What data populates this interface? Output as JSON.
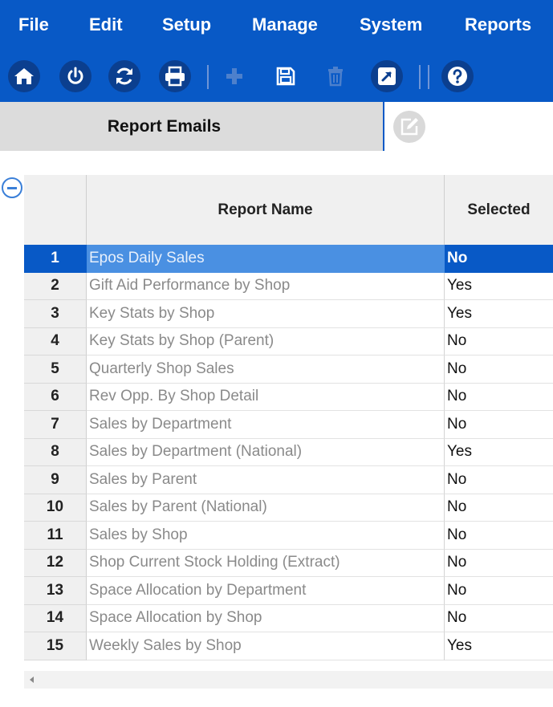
{
  "menu": {
    "file": "File",
    "edit": "Edit",
    "setup": "Setup",
    "manage": "Manage",
    "system": "System",
    "reports": "Reports"
  },
  "toolbar": {
    "icons": [
      "home-icon",
      "power-icon",
      "refresh-icon",
      "print-icon",
      "add-icon",
      "save-icon",
      "delete-icon",
      "export-icon",
      "help-icon"
    ],
    "disabled": [
      "add-icon",
      "delete-icon"
    ]
  },
  "tab": {
    "label": "Report Emails"
  },
  "grid": {
    "headers": {
      "name": "Report Name",
      "selected": "Selected"
    },
    "rows": [
      {
        "num": "1",
        "name": "Epos Daily Sales",
        "selected": "No"
      },
      {
        "num": "2",
        "name": "Gift Aid Performance by Shop",
        "selected": "Yes"
      },
      {
        "num": "3",
        "name": "Key Stats by Shop",
        "selected": "Yes"
      },
      {
        "num": "4",
        "name": "Key Stats by Shop (Parent)",
        "selected": "No"
      },
      {
        "num": "5",
        "name": "Quarterly Shop Sales",
        "selected": "No"
      },
      {
        "num": "6",
        "name": "Rev Opp. By Shop Detail",
        "selected": "No"
      },
      {
        "num": "7",
        "name": "Sales by Department",
        "selected": "No"
      },
      {
        "num": "8",
        "name": "Sales by Department (National)",
        "selected": "Yes"
      },
      {
        "num": "9",
        "name": "Sales by Parent",
        "selected": "No"
      },
      {
        "num": "10",
        "name": "Sales by Parent (National)",
        "selected": "No"
      },
      {
        "num": "11",
        "name": "Sales by Shop",
        "selected": "No"
      },
      {
        "num": "12",
        "name": "Shop Current Stock Holding (Extract)",
        "selected": "No"
      },
      {
        "num": "13",
        "name": "Space Allocation by Department",
        "selected": "No"
      },
      {
        "num": "14",
        "name": "Space Allocation by Shop",
        "selected": "No"
      },
      {
        "num": "15",
        "name": "Weekly Sales by Shop",
        "selected": "Yes"
      }
    ],
    "selected_row": "1"
  },
  "colors": {
    "primary": "#0859c6",
    "icon_bg": "#0b3f8f",
    "row_highlight": "#4a90e2",
    "header_bg": "#f0f0f0"
  }
}
